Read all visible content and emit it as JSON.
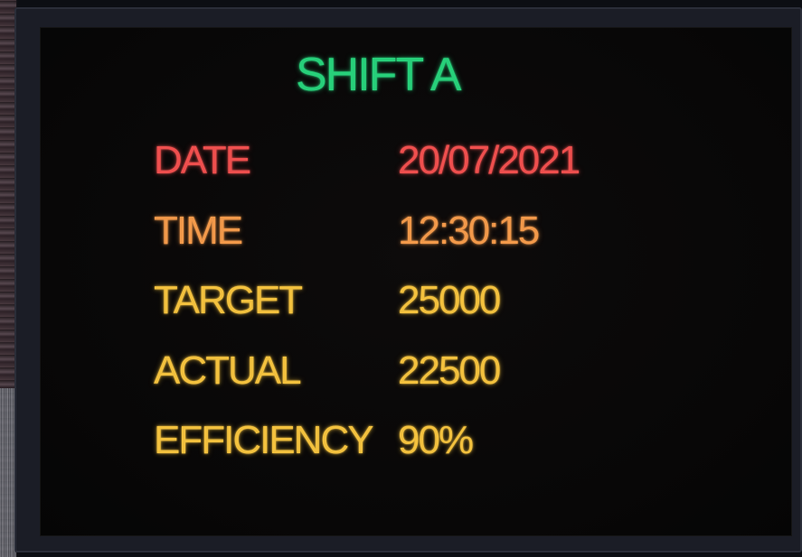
{
  "board": {
    "title": "SHIFT A",
    "rows": [
      {
        "label": "DATE",
        "value": "20/07/2021"
      },
      {
        "label": "TIME",
        "value": "12:30:15"
      },
      {
        "label": "TARGET",
        "value": "25000"
      },
      {
        "label": "ACTUAL",
        "value": "22500"
      },
      {
        "label": "EFFICIENCY",
        "value": "90%"
      }
    ]
  },
  "colors": {
    "title": "#27d07a",
    "date": "#ef4f4e",
    "time": "#f2994a",
    "metrics": "#f3c13e",
    "screen_background": "#080707",
    "frame": "#1b1d26"
  }
}
